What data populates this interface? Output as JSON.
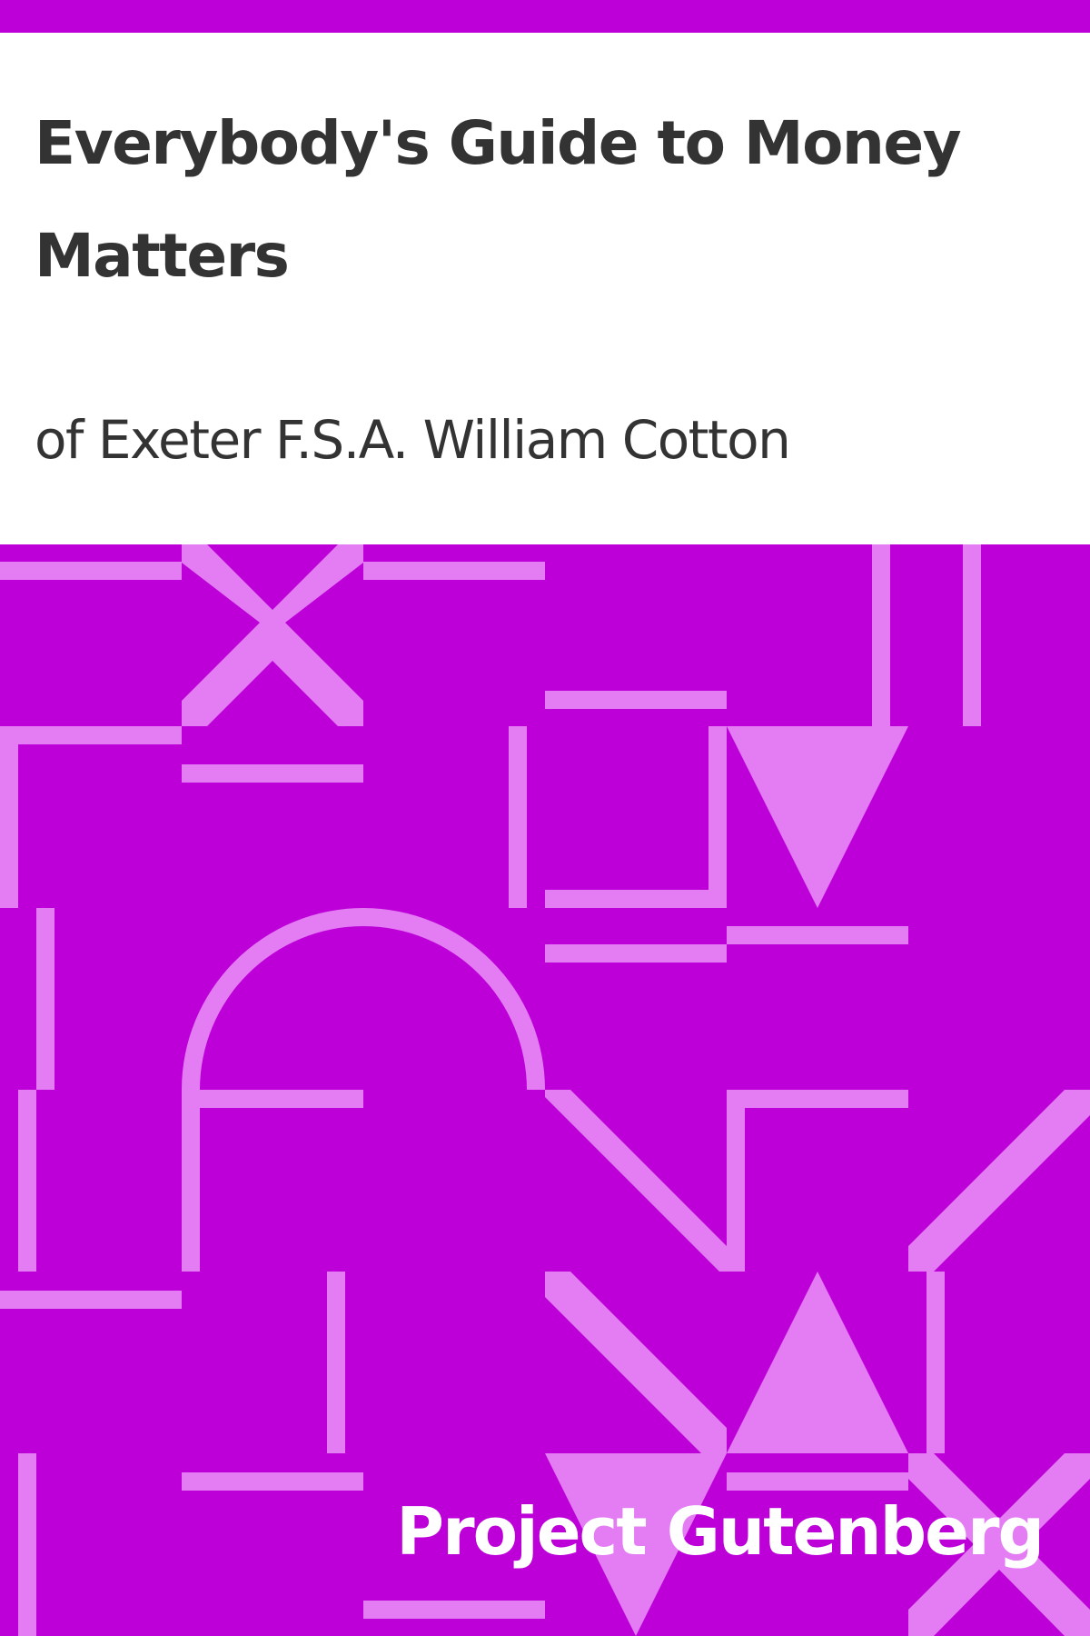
{
  "cover": {
    "title": "Everybody's Guide to Money Matters",
    "author": "of Exeter F.S.A. William Cotton",
    "publisher": "Project Gutenberg"
  },
  "colors": {
    "background": "#bd00d8",
    "pattern": "#e47df4",
    "title_panel": "#ffffff",
    "title_text": "#333333",
    "publisher_text": "#ffffff"
  }
}
